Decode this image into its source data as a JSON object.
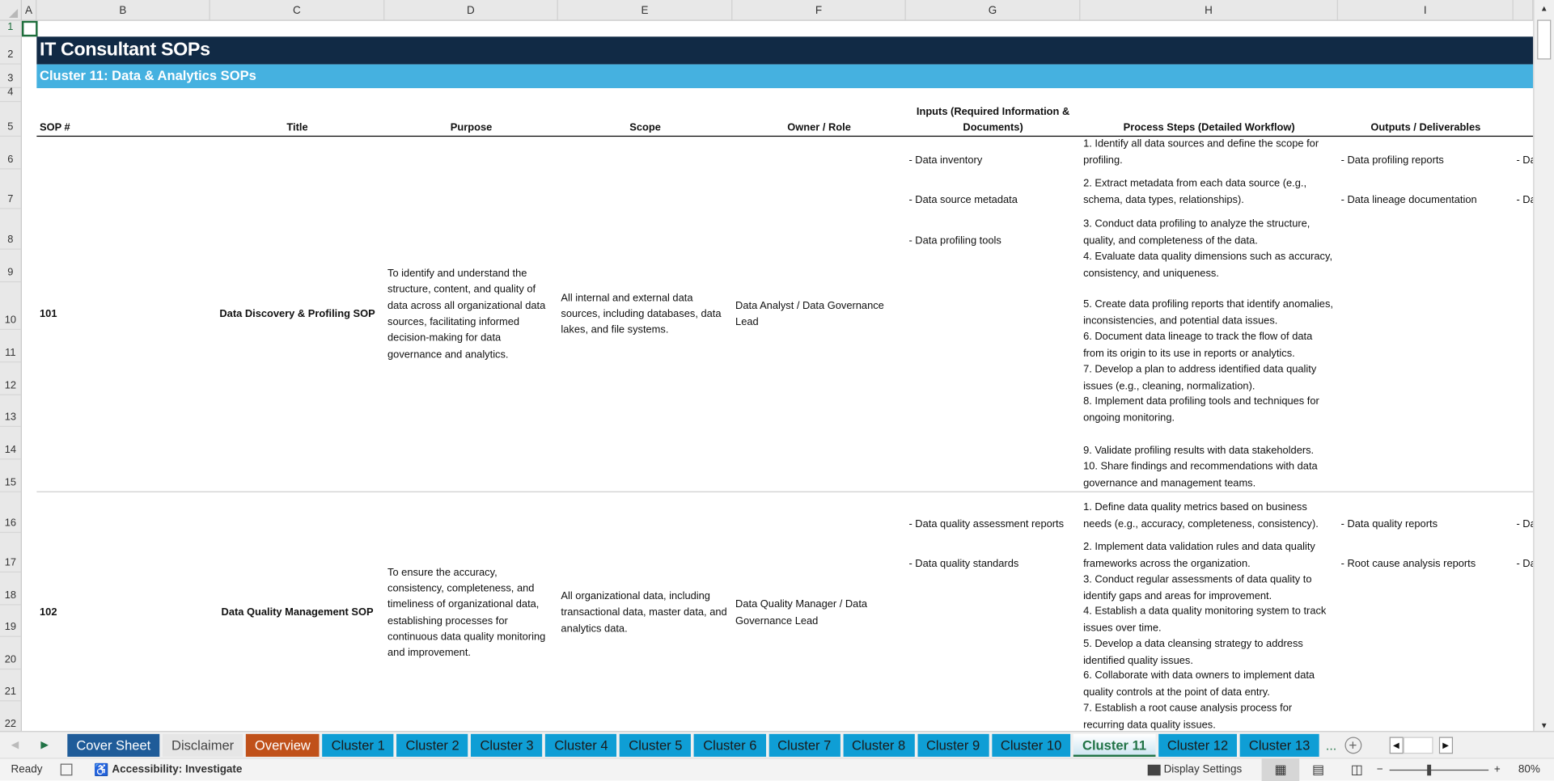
{
  "columns": [
    "A",
    "B",
    "C",
    "D",
    "E",
    "F",
    "G",
    "H",
    "I"
  ],
  "rows": [
    "1",
    "2",
    "3",
    "4",
    "5",
    "6",
    "7",
    "8",
    "9",
    "10",
    "11",
    "12",
    "13",
    "14",
    "15",
    "16",
    "17",
    "18",
    "19",
    "20",
    "21",
    "22"
  ],
  "title": "IT Consultant SOPs",
  "subtitle": "Cluster 11: Data & Analytics SOPs",
  "headers": [
    "SOP #",
    "Title",
    "Purpose",
    "Scope",
    "Owner / Role",
    "Inputs (Required Information & Documents)",
    "Process Steps (Detailed Workflow)",
    "Outputs / Deliverables"
  ],
  "sops": [
    {
      "number": "101",
      "title": "Data Discovery & Profiling SOP",
      "purpose": "To identify and understand the structure, content, and quality of data across all organizational data sources, facilitating informed decision-making for data governance and analytics.",
      "scope": "All internal and external data sources, including databases, data lakes, and file systems.",
      "owner": "Data Analyst / Data Governance Lead",
      "inputs": [
        "- Data inventory",
        "- Data source metadata",
        "- Data profiling tools"
      ],
      "steps": [
        "1. Identify all data sources and define the scope for profiling.",
        "2. Extract metadata from each data source (e.g., schema, data types, relationships).",
        "3. Conduct data profiling to analyze the structure, quality, and completeness of the data.",
        "4. Evaluate data quality dimensions such as accuracy, consistency, and uniqueness.",
        "5. Create data profiling reports that identify anomalies, inconsistencies, and potential data issues.",
        "6. Document data lineage to track the flow of data from its origin to its use in reports or analytics.",
        "7. Develop a plan to address identified data quality issues (e.g., cleaning, normalization).",
        "8. Implement data profiling tools and techniques for ongoing monitoring.",
        "9. Validate profiling results with data stakeholders.",
        "10. Share findings and recommendations with data governance and management teams."
      ],
      "outputs": [
        "- Data profiling reports",
        "- Data lineage documentation"
      ],
      "next_col": [
        "- Da",
        "- Da"
      ]
    },
    {
      "number": "102",
      "title": "Data Quality Management SOP",
      "purpose": "To ensure the accuracy, consistency, completeness, and timeliness of organizational data, establishing processes for continuous data quality monitoring and improvement.",
      "scope": "All organizational data, including transactional data, master data, and analytics data.",
      "owner": "Data Quality Manager / Data Governance Lead",
      "inputs": [
        "- Data quality assessment reports",
        "- Data quality standards"
      ],
      "steps": [
        "1. Define data quality metrics based on business needs (e.g., accuracy, completeness, consistency).",
        "2. Implement data validation rules and data quality frameworks across the organization.",
        "3. Conduct regular assessments of data quality to identify gaps and areas for improvement.",
        "4. Establish a data quality monitoring system to track issues over time.",
        "5. Develop a data cleansing strategy to address identified quality issues.",
        "6. Collaborate with data owners to implement data quality controls at the point of data entry.",
        "7. Establish a root cause analysis process for recurring data quality issues."
      ],
      "outputs": [
        "- Data quality reports",
        "- Root cause analysis reports"
      ],
      "next_col": [
        "- Da",
        "- Da"
      ]
    }
  ],
  "tabs": [
    {
      "label": "Cover Sheet",
      "bg": "#1f5c99",
      "fg": "#ffffff"
    },
    {
      "label": "Disclaimer",
      "bg": "#e6e6e6",
      "fg": "#444444"
    },
    {
      "label": "Overview",
      "bg": "#c0511a",
      "fg": "#ffffff"
    },
    {
      "label": "Cluster 1",
      "bg": "#0f9ed5",
      "fg": "#1a1a1a"
    },
    {
      "label": "Cluster 2",
      "bg": "#0f9ed5",
      "fg": "#1a1a1a"
    },
    {
      "label": "Cluster 3",
      "bg": "#0f9ed5",
      "fg": "#1a1a1a"
    },
    {
      "label": "Cluster 4",
      "bg": "#0f9ed5",
      "fg": "#1a1a1a"
    },
    {
      "label": "Cluster 5",
      "bg": "#0f9ed5",
      "fg": "#1a1a1a"
    },
    {
      "label": "Cluster 6",
      "bg": "#0f9ed5",
      "fg": "#1a1a1a"
    },
    {
      "label": "Cluster 7",
      "bg": "#0f9ed5",
      "fg": "#1a1a1a"
    },
    {
      "label": "Cluster 8",
      "bg": "#0f9ed5",
      "fg": "#1a1a1a"
    },
    {
      "label": "Cluster 9",
      "bg": "#0f9ed5",
      "fg": "#1a1a1a"
    },
    {
      "label": "Cluster 10",
      "bg": "#0f9ed5",
      "fg": "#1a1a1a"
    },
    {
      "label": "Cluster 11",
      "bg": "",
      "fg": "",
      "active": true
    },
    {
      "label": "Cluster 12",
      "bg": "#0f9ed5",
      "fg": "#1a1a1a"
    },
    {
      "label": "Cluster 13",
      "bg": "#0f9ed5",
      "fg": "#1a1a1a"
    }
  ],
  "tabs_more": "...",
  "status": {
    "ready": "Ready",
    "accessibility": "Accessibility: Investigate",
    "display_settings": "Display Settings",
    "zoom": "80%",
    "zoom_minus": "−",
    "zoom_plus": "+"
  }
}
